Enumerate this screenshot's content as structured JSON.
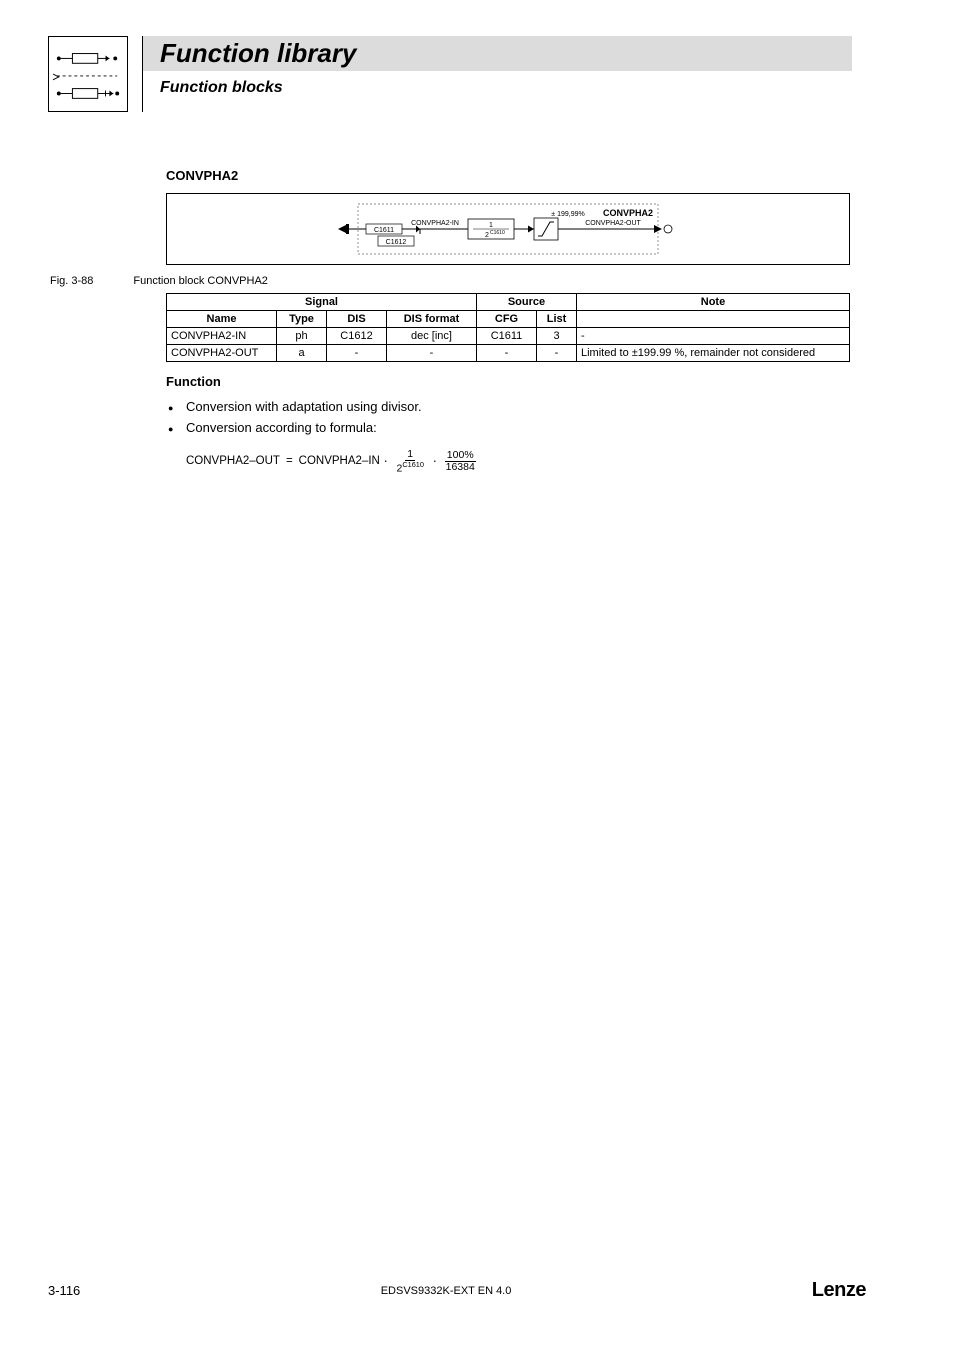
{
  "header": {
    "title": "Function library",
    "subtitle": "Function blocks"
  },
  "section": {
    "heading": "CONVPHA2"
  },
  "diagram": {
    "blockTitle": "CONVPHA2",
    "inLabel": "CONVPHA2-IN",
    "outLabel": "CONVPHA2-OUT",
    "limit": "± 199,99%",
    "c1611": "C1611",
    "c1612": "C1612",
    "fracNum": "1",
    "fracBase": "2",
    "fracExp": "C1610"
  },
  "figure": {
    "num": "Fig. 3-88",
    "caption": "Function block CONVPHA2"
  },
  "table": {
    "headSignal": "Signal",
    "headSource": "Source",
    "headNote": "Note",
    "headName": "Name",
    "headType": "Type",
    "headDIS": "DIS",
    "headDISformat": "DIS format",
    "headCFG": "CFG",
    "headList": "List",
    "rows": [
      {
        "name": "CONVPHA2-IN",
        "type": "ph",
        "dis": "C1612",
        "disf": "dec [inc]",
        "cfg": "C1611",
        "list": "3",
        "note": "-"
      },
      {
        "name": "CONVPHA2-OUT",
        "type": "a",
        "dis": "-",
        "disf": "-",
        "cfg": "-",
        "list": "-",
        "note": "Limited to ±199.99 %, remainder not considered"
      }
    ]
  },
  "function": {
    "heading": "Function",
    "bullets": [
      "Conversion with adaptation using divisor.",
      "Conversion according to formula:"
    ],
    "formula": {
      "lhs": "CONVPHA2–OUT",
      "eq": "=",
      "rhs1": "CONVPHA2–IN",
      "dot": "⋅",
      "frac1num": "1",
      "frac1denBase": "2",
      "frac1denExp": "C1610",
      "frac2num": "100%",
      "frac2den": "16384"
    }
  },
  "footer": {
    "page": "3-116",
    "docid": "EDSVS9332K-EXT EN 4.0",
    "brand": "Lenze"
  }
}
